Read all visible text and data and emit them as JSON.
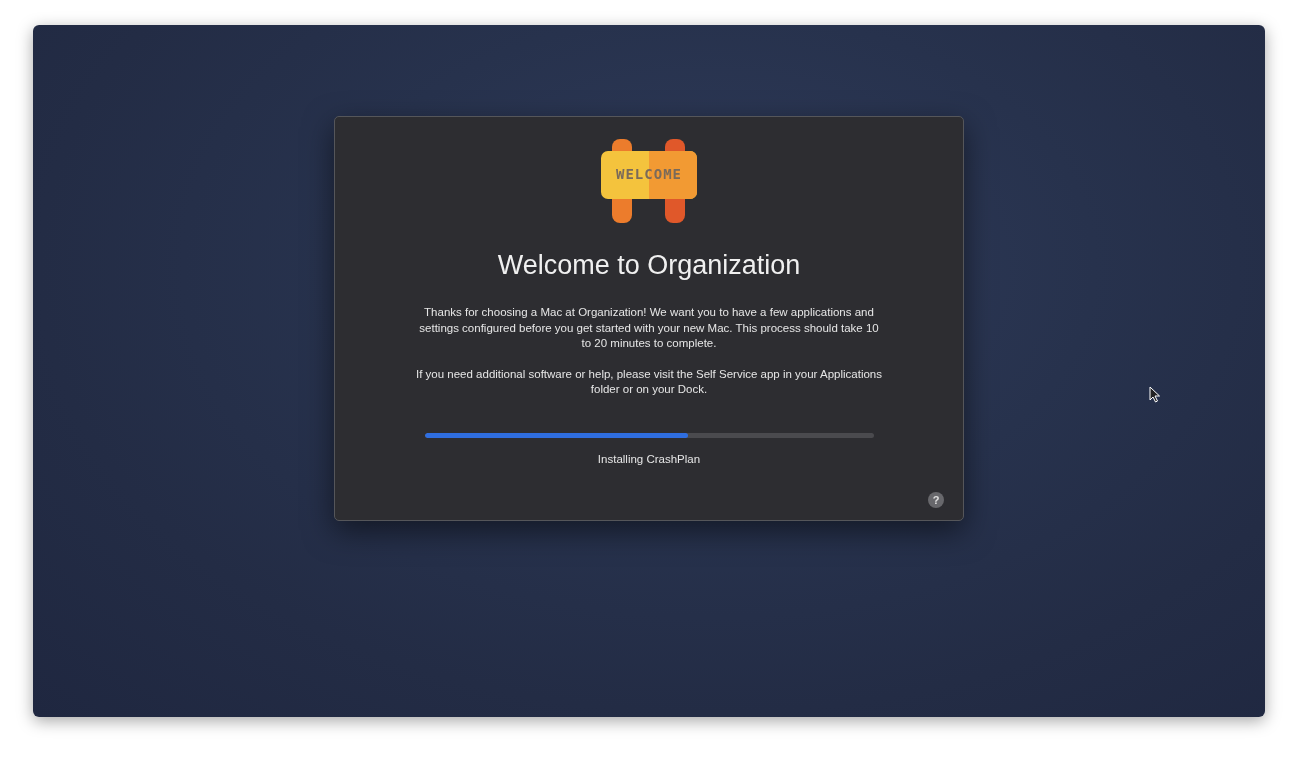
{
  "dialog": {
    "sign_text": "WELCOME",
    "title": "Welcome to Organization",
    "paragraphs": [
      "Thanks for choosing a Mac at Organization! We want you to have a few applications and settings configured before you get started with your new Mac. This process should take 10 to 20 minutes to complete.",
      "If you need additional software or help, please visit the Self Service app in your Applications folder or on your Dock."
    ],
    "progress": {
      "level": 0.587,
      "status": "Installing CrashPlan"
    },
    "help_button": "?"
  }
}
